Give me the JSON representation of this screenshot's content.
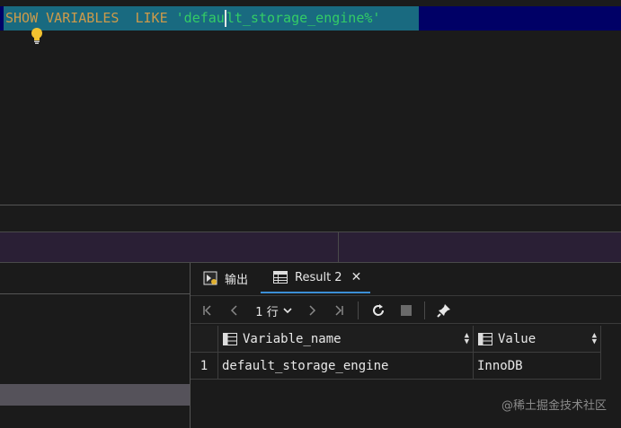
{
  "editor": {
    "sql_keyword1": "SHOW VARIABLES",
    "sql_keyword2": "LIKE",
    "sql_string_part1": "'defau",
    "sql_string_part2": "lt_storage_engine%'",
    "hint_icon": "lightbulb-icon"
  },
  "tabs": [
    {
      "label": "输出",
      "icon": "output-icon"
    },
    {
      "label": "Result 2",
      "icon": "table-icon",
      "active": true
    }
  ],
  "toolbar": {
    "row_count": "1 行",
    "icons": [
      "first-page-icon",
      "prev-page-icon",
      "row-count-dropdown",
      "next-page-icon",
      "last-page-icon",
      "refresh-icon",
      "stop-icon",
      "pin-icon"
    ]
  },
  "grid": {
    "columns": [
      "Variable_name",
      "Value"
    ],
    "rows": [
      {
        "index": "1",
        "cells": [
          "default_storage_engine",
          "InnoDB"
        ]
      }
    ]
  },
  "watermark": "@稀土掘金技术社区",
  "colors": {
    "accent": "#3c8fd6",
    "keyword": "#cc9a4a",
    "string": "#33cc66",
    "selection": "#196a80"
  }
}
